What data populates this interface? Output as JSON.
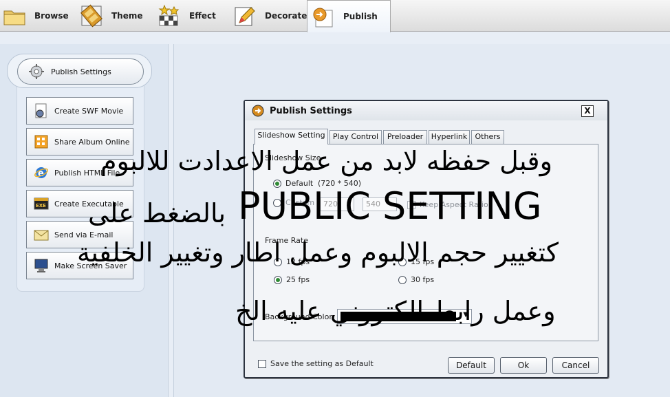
{
  "toolbar": {
    "tabs": [
      {
        "label": "Browse",
        "icon": "folder-icon"
      },
      {
        "label": "Theme",
        "icon": "film-strip-icon"
      },
      {
        "label": "Effect",
        "icon": "stars-icon"
      },
      {
        "label": "Decorate",
        "icon": "pencil-icon"
      },
      {
        "label": "Publish",
        "icon": "publish-icon",
        "active": true
      }
    ]
  },
  "sidebar": {
    "header": "Publish Settings",
    "items": [
      {
        "label": "Create SWF Movie",
        "icon": "swf-icon"
      },
      {
        "label": "Share Album Online",
        "icon": "share-icon"
      },
      {
        "label": "Publish HTML File",
        "icon": "ie-icon"
      },
      {
        "label": "Create Executable",
        "icon": "exe-icon"
      },
      {
        "label": "Send via E-mail",
        "icon": "email-icon"
      },
      {
        "label": "Make Screen Saver",
        "icon": "monitor-icon"
      }
    ]
  },
  "dialog": {
    "title": "Publish Settings",
    "close": "X",
    "tabs": [
      "Slideshow Setting",
      "Play Control",
      "Preloader",
      "Hyperlink",
      "Others"
    ],
    "slideshow_size": {
      "label": "Slideshow Size",
      "default_label": "Default",
      "default_value": "(720 * 540)",
      "custom_label": "Custom",
      "width": "720",
      "height": "540",
      "keep_aspect": "Keep Aspect Ratio"
    },
    "frame_rate": {
      "label": "Frame Rate",
      "options": [
        "12 fps",
        "15 fps",
        "25 fps",
        "30 fps"
      ],
      "selected": "25 fps"
    },
    "background": {
      "label": "Background Color",
      "color": "#000000"
    },
    "save_default": "Save the setting as Default",
    "buttons": {
      "default": "Default",
      "ok": "Ok",
      "cancel": "Cancel"
    }
  },
  "overlay": {
    "line1": "وقبل حفظه لابد من عمل الاعدادت للالبوم",
    "line2": "PUBLIC SETTING",
    "line3": "بالضغط على",
    "line4": "كتغيير حجم الالبوم وعمل اطار وتغيير الخلفية",
    "line5": "وعمل رابط الكتروني عليه الخ"
  }
}
